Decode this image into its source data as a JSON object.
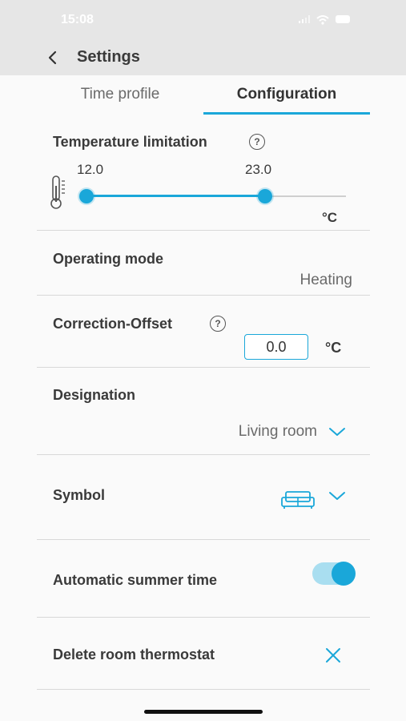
{
  "status": {
    "time": "15:08"
  },
  "nav": {
    "title": "Settings"
  },
  "tabs": [
    {
      "label": "Time profile",
      "active": false
    },
    {
      "label": "Configuration",
      "active": true
    }
  ],
  "temperature_limitation": {
    "label": "Temperature limitation",
    "min": "12.0",
    "max": "23.0",
    "unit": "°C"
  },
  "operating_mode": {
    "label": "Operating mode",
    "value": "Heating"
  },
  "correction_offset": {
    "label": "Correction-Offset",
    "value": "0.0",
    "unit": "°C"
  },
  "designation": {
    "label": "Designation",
    "value": "Living room"
  },
  "symbol": {
    "label": "Symbol",
    "icon": "sofa-icon"
  },
  "summer_time": {
    "label": "Automatic summer time",
    "enabled": true
  },
  "delete": {
    "label": "Delete room thermostat"
  },
  "colors": {
    "accent": "#1aa7d9",
    "text": "#3a3a3a"
  }
}
